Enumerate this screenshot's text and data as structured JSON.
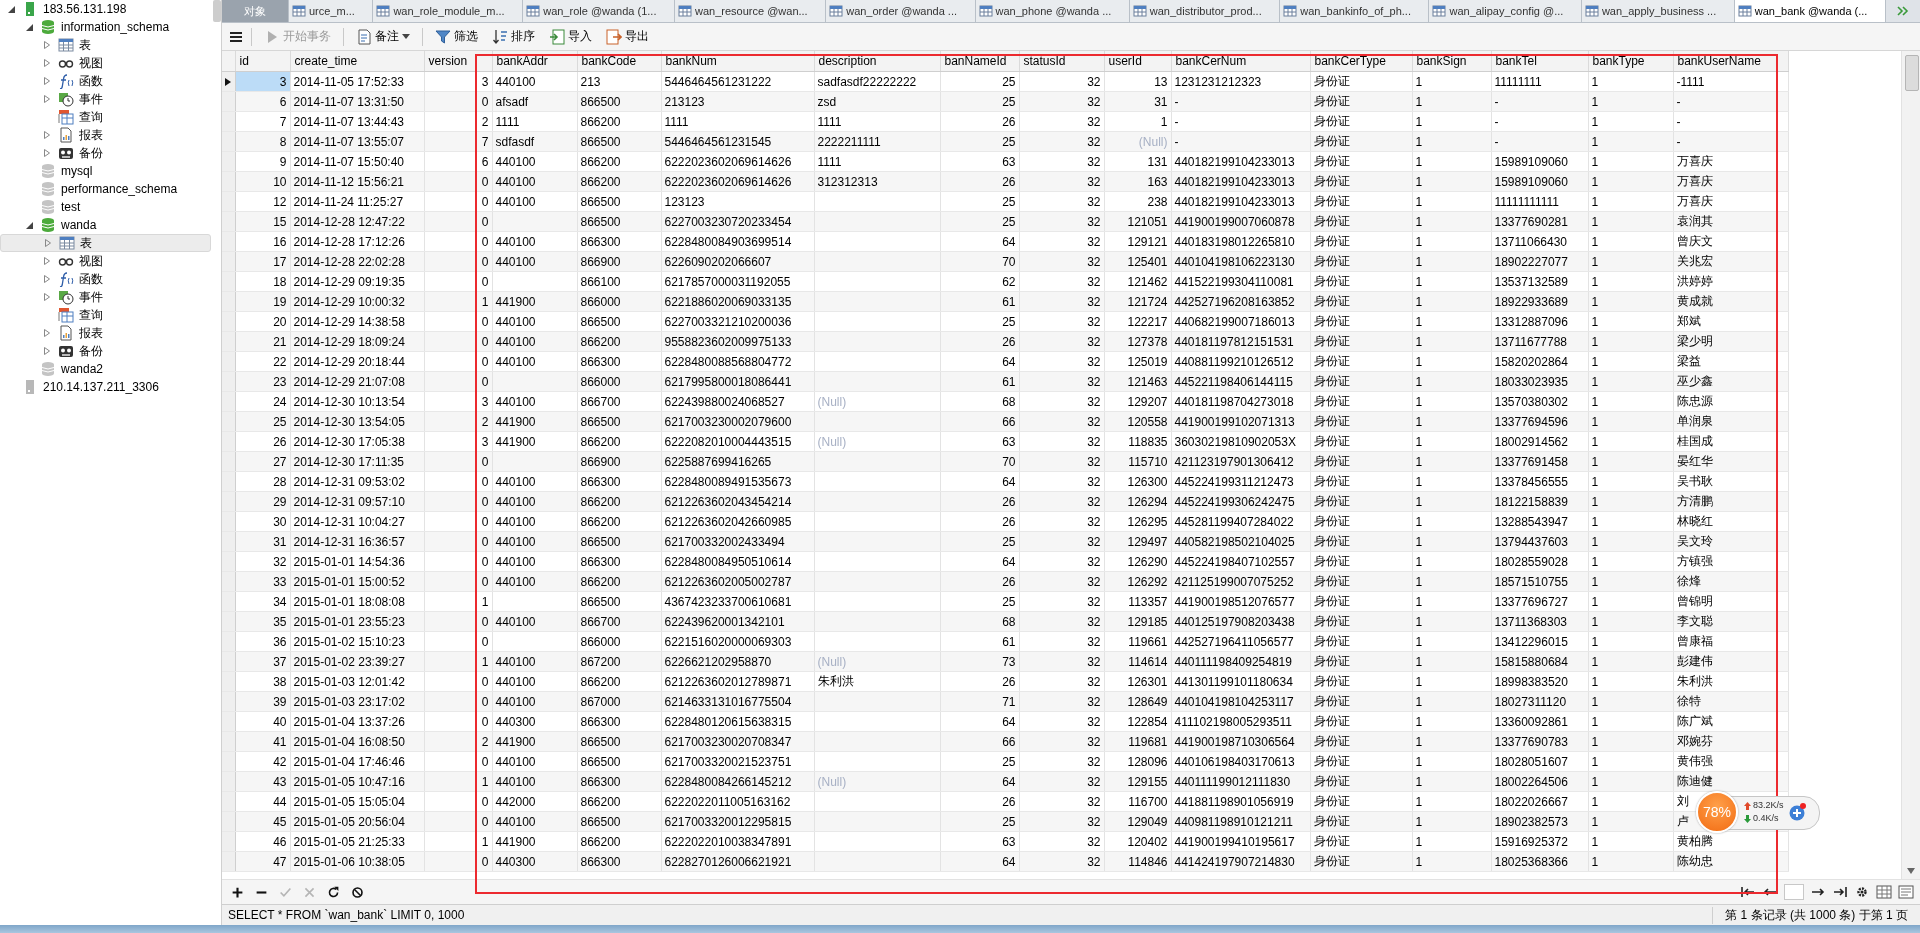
{
  "sidebar": {
    "tree": [
      {
        "kind": "server",
        "label": "183.56.131.198",
        "connected": true,
        "expanded": true,
        "selected": false,
        "children": [
          {
            "kind": "database",
            "label": "information_schema",
            "connected": true,
            "expanded": true,
            "selected": false,
            "children": [
              {
                "kind": "tables",
                "label": "表",
                "expanded": false,
                "selected": false
              },
              {
                "kind": "views",
                "label": "视图",
                "expanded": false,
                "selected": false
              },
              {
                "kind": "functions",
                "label": "函数",
                "expanded": false,
                "selected": false
              },
              {
                "kind": "events",
                "label": "事件",
                "expanded": false,
                "selected": false
              },
              {
                "kind": "queries",
                "label": "查询",
                "selected": false
              },
              {
                "kind": "reports",
                "label": "报表",
                "expanded": false,
                "selected": false
              },
              {
                "kind": "backups",
                "label": "备份",
                "expanded": false,
                "selected": false
              }
            ]
          },
          {
            "kind": "database",
            "label": "mysql",
            "connected": false,
            "selected": false
          },
          {
            "kind": "database",
            "label": "performance_schema",
            "connected": false,
            "selected": false
          },
          {
            "kind": "database",
            "label": "test",
            "connected": false,
            "selected": false
          },
          {
            "kind": "database",
            "label": "wanda",
            "connected": true,
            "expanded": true,
            "selected": false,
            "children": [
              {
                "kind": "tables",
                "label": "表",
                "expanded": false,
                "selected": true
              },
              {
                "kind": "views",
                "label": "视图",
                "expanded": false,
                "selected": false
              },
              {
                "kind": "functions",
                "label": "函数",
                "expanded": false,
                "selected": false
              },
              {
                "kind": "events",
                "label": "事件",
                "expanded": false,
                "selected": false
              },
              {
                "kind": "queries",
                "label": "查询",
                "selected": false
              },
              {
                "kind": "reports",
                "label": "报表",
                "expanded": false,
                "selected": false
              },
              {
                "kind": "backups",
                "label": "备份",
                "expanded": false,
                "selected": false
              }
            ]
          },
          {
            "kind": "database",
            "label": "wanda2",
            "connected": false,
            "selected": false
          }
        ]
      },
      {
        "kind": "server",
        "label": "210.14.137.211_3306",
        "connected": false,
        "selected": false
      }
    ]
  },
  "tabs": [
    {
      "kind": "objects",
      "label": "对象",
      "selected": false
    },
    {
      "kind": "table",
      "label": "urce_m...",
      "selected": false
    },
    {
      "kind": "table",
      "label": "wan_role_module_m...",
      "selected": false
    },
    {
      "kind": "table",
      "label": "wan_role @wanda (1...",
      "selected": false
    },
    {
      "kind": "table",
      "label": "wan_resource @wan...",
      "selected": false
    },
    {
      "kind": "table",
      "label": "wan_order @wanda ...",
      "selected": false
    },
    {
      "kind": "table",
      "label": "wan_phone @wanda ...",
      "selected": false
    },
    {
      "kind": "table",
      "label": "wan_distributor_prod...",
      "selected": false
    },
    {
      "kind": "table",
      "label": "wan_bankinfo_of_ph...",
      "selected": false
    },
    {
      "kind": "table",
      "label": "wan_alipay_config @...",
      "selected": false
    },
    {
      "kind": "table",
      "label": "wan_apply_business ...",
      "selected": false
    },
    {
      "kind": "table",
      "label": "wan_bank @wanda (...",
      "selected": true
    }
  ],
  "toolbar": {
    "buttons": [
      {
        "kind": "transaction",
        "label": "开始事务",
        "disabled": true
      },
      {
        "kind": "memo",
        "label": "备注",
        "disabled": false,
        "dropdown": true
      },
      {
        "kind": "filter",
        "label": "筛选",
        "disabled": false
      },
      {
        "kind": "sort",
        "label": "排序",
        "disabled": false
      },
      {
        "kind": "import",
        "label": "导入",
        "disabled": false
      },
      {
        "kind": "export",
        "label": "导出",
        "disabled": false
      }
    ]
  },
  "table": {
    "columns": [
      {
        "label": "id"
      },
      {
        "label": "create_time"
      },
      {
        "label": "version"
      },
      {
        "label": "bankAddr"
      },
      {
        "label": "bankCode"
      },
      {
        "label": "bankNum"
      },
      {
        "label": "description"
      },
      {
        "label": "banNameId"
      },
      {
        "label": "statusId"
      },
      {
        "label": "userId"
      },
      {
        "label": "bankCerNum"
      },
      {
        "label": "bankCerType"
      },
      {
        "label": "bankSign"
      },
      {
        "label": "bankTel"
      },
      {
        "label": "bankType"
      },
      {
        "label": "bankUserName"
      }
    ],
    "rows": [
      {
        "selected": true,
        "cells": [
          "3",
          "2014-11-05 17:52:33",
          "3",
          "440100",
          "213",
          "5446464561231222",
          "sadfasdf22222222",
          "25",
          "32",
          "13",
          "1231231212323",
          "身份证",
          "1",
          "11111111",
          "1",
          "-1111"
        ]
      },
      {
        "selected": false,
        "cells": [
          "6",
          "2014-11-07 13:31:50",
          "0",
          "afsadf",
          "866500",
          "213123",
          "zsd",
          "25",
          "32",
          "31",
          "-",
          "身份证",
          "1",
          "-",
          "1",
          "-"
        ]
      },
      {
        "selected": false,
        "cells": [
          "7",
          "2014-11-07 13:44:43",
          "2",
          "1111",
          "866200",
          "1111",
          "1111",
          "26",
          "32",
          "1",
          "-",
          "身份证",
          "1",
          "-",
          "1",
          "-"
        ]
      },
      {
        "selected": false,
        "cells": [
          "8",
          "2014-11-07 13:55:07",
          "7",
          "sdfasdf",
          "866500",
          "5446464561231545",
          "2222211111",
          "25",
          "32",
          {
            "text": "(Null)",
            "null": true
          },
          "-",
          "身份证",
          "1",
          "-",
          "1",
          "-"
        ]
      },
      {
        "selected": false,
        "cells": [
          "9",
          "2014-11-07 15:50:40",
          "6",
          "440100",
          "866200",
          "6222023602069614626",
          "1111",
          "63",
          "32",
          "131",
          "440182199104233013",
          "身份证",
          "1",
          "15989109060",
          "1",
          "万喜庆"
        ]
      },
      {
        "selected": false,
        "cells": [
          "10",
          "2014-11-12 15:56:21",
          "0",
          "440100",
          "866200",
          "6222023602069614626",
          "312312313",
          "26",
          "32",
          "163",
          "440182199104233013",
          "身份证",
          "1",
          "15989109060",
          "1",
          "万喜庆"
        ]
      },
      {
        "selected": false,
        "cells": [
          "12",
          "2014-11-24 11:25:27",
          "0",
          "440100",
          "866500",
          "123123",
          null,
          "25",
          "32",
          "238",
          "440182199104233013",
          "身份证",
          "1",
          "11111111111",
          "1",
          "万喜庆"
        ]
      },
      {
        "selected": false,
        "cells": [
          "15",
          "2014-12-28 12:47:22",
          "0",
          null,
          "866500",
          "6227003230720233454",
          null,
          "25",
          "32",
          "121051",
          "441900199007060878",
          "身份证",
          "1",
          "13377690281",
          "1",
          "袁润其"
        ]
      },
      {
        "selected": false,
        "cells": [
          "16",
          "2014-12-28 17:12:26",
          "0",
          "440100",
          "866300",
          "6228480084903699514",
          null,
          "64",
          "32",
          "129121",
          "440183198012265810",
          "身份证",
          "1",
          "13711066430",
          "1",
          "曾庆文"
        ]
      },
      {
        "selected": false,
        "cells": [
          "17",
          "2014-12-28 22:02:28",
          "0",
          "440100",
          "866900",
          "6226090202066607",
          null,
          "70",
          "32",
          "125401",
          "440104198106223130",
          "身份证",
          "1",
          "18902227077",
          "1",
          "关兆宏"
        ]
      },
      {
        "selected": false,
        "cells": [
          "18",
          "2014-12-29 09:19:35",
          "0",
          null,
          "866100",
          "6217857000031192055",
          null,
          "62",
          "32",
          "121462",
          "441522199304110081",
          "身份证",
          "1",
          "13537132589",
          "1",
          "洪婷婷"
        ]
      },
      {
        "selected": false,
        "cells": [
          "19",
          "2014-12-29 10:00:32",
          "1",
          "441900",
          "866000",
          "6221886020069033135",
          null,
          "61",
          "32",
          "121724",
          "442527196208163852",
          "身份证",
          "1",
          "18922933689",
          "1",
          "黄成就"
        ]
      },
      {
        "selected": false,
        "cells": [
          "20",
          "2014-12-29 14:38:58",
          "0",
          "440100",
          "866500",
          "6227003321210200036",
          null,
          "25",
          "32",
          "122217",
          "440682199007186013",
          "身份证",
          "1",
          "13312887096",
          "1",
          "郑斌"
        ]
      },
      {
        "selected": false,
        "cells": [
          "21",
          "2014-12-29 18:09:24",
          "0",
          "440100",
          "866200",
          "9558823602009975133",
          null,
          "26",
          "32",
          "127378",
          "440181197812151531",
          "身份证",
          "1",
          "13711677788",
          "1",
          "梁少明"
        ]
      },
      {
        "selected": false,
        "cells": [
          "22",
          "2014-12-29 20:18:44",
          "0",
          "440100",
          "866300",
          "6228480088568804772",
          null,
          "64",
          "32",
          "125019",
          "440881199210126512",
          "身份证",
          "1",
          "15820202864",
          "1",
          "梁益"
        ]
      },
      {
        "selected": false,
        "cells": [
          "23",
          "2014-12-29 21:07:08",
          "0",
          null,
          "866000",
          "6217995800018086441",
          null,
          "61",
          "32",
          "121463",
          "445221198406144115",
          "身份证",
          "1",
          "18033023935",
          "1",
          "巫少鑫"
        ]
      },
      {
        "selected": false,
        "cells": [
          "24",
          "2014-12-30 10:13:54",
          "3",
          "440100",
          "866700",
          "622439880024068527",
          {
            "text": "(Null)",
            "null": true
          },
          "68",
          "32",
          "129207",
          "440181198704273018",
          "身份证",
          "1",
          "13570380302",
          "1",
          "陈忠源"
        ]
      },
      {
        "selected": false,
        "cells": [
          "25",
          "2014-12-30 13:54:05",
          "2",
          "441900",
          "866500",
          "6217003230002079600",
          null,
          "66",
          "32",
          "120558",
          "441900199102071313",
          "身份证",
          "1",
          "13377694596",
          "1",
          "单润泉"
        ]
      },
      {
        "selected": false,
        "cells": [
          "26",
          "2014-12-30 17:05:38",
          "3",
          "441900",
          "866200",
          "6222082010004443515",
          {
            "text": "(Null)",
            "null": true
          },
          "63",
          "32",
          "118835",
          "36030219810902053X",
          "身份证",
          "1",
          "18002914562",
          "1",
          "桂国成"
        ]
      },
      {
        "selected": false,
        "cells": [
          "27",
          "2014-12-30 17:11:35",
          "0",
          null,
          "866900",
          "6225887699416265",
          null,
          "70",
          "32",
          "115710",
          "421123197901306412",
          "身份证",
          "1",
          "13377691458",
          "1",
          "晏红华"
        ]
      },
      {
        "selected": false,
        "cells": [
          "28",
          "2014-12-31 09:53:02",
          "0",
          "440100",
          "866300",
          "6228480089491535673",
          null,
          "64",
          "32",
          "126300",
          "445224199311212473",
          "身份证",
          "1",
          "13378456555",
          "1",
          "吴书耿"
        ]
      },
      {
        "selected": false,
        "cells": [
          "29",
          "2014-12-31 09:57:10",
          "0",
          "440100",
          "866200",
          "6212263602043454214",
          null,
          "26",
          "32",
          "126294",
          "445224199306242475",
          "身份证",
          "1",
          "18122158839",
          "1",
          "方清鹏"
        ]
      },
      {
        "selected": false,
        "cells": [
          "30",
          "2014-12-31 10:04:27",
          "0",
          "440100",
          "866200",
          "6212263602042660985",
          null,
          "26",
          "32",
          "126295",
          "445281199407284022",
          "身份证",
          "1",
          "13288543947",
          "1",
          "林晓红"
        ]
      },
      {
        "selected": false,
        "cells": [
          "31",
          "2014-12-31 16:36:57",
          "0",
          "440100",
          "866500",
          "621700332002433494",
          null,
          "25",
          "32",
          "129497",
          "440582198502104025",
          "身份证",
          "1",
          "13794437603",
          "1",
          "吴文玲"
        ]
      },
      {
        "selected": false,
        "cells": [
          "32",
          "2015-01-01 14:54:36",
          "0",
          "440100",
          "866300",
          "6228480084950510614",
          null,
          "64",
          "32",
          "126290",
          "445224198407102557",
          "身份证",
          "1",
          "18028559028",
          "1",
          "方镇强"
        ]
      },
      {
        "selected": false,
        "cells": [
          "33",
          "2015-01-01 15:00:52",
          "0",
          "440100",
          "866200",
          "6212263602005002787",
          null,
          "26",
          "32",
          "126292",
          "421125199007075252",
          "身份证",
          "1",
          "18571510755",
          "1",
          "徐烽"
        ]
      },
      {
        "selected": false,
        "cells": [
          "34",
          "2015-01-01 18:08:08",
          "1",
          null,
          "866500",
          "4367423233700610681",
          null,
          "25",
          "32",
          "113357",
          "441900198512076577",
          "身份证",
          "1",
          "13377696727",
          "1",
          "曾锦明"
        ]
      },
      {
        "selected": false,
        "cells": [
          "35",
          "2015-01-01 23:55:23",
          "0",
          "440100",
          "866700",
          "622439620001342101",
          null,
          "68",
          "32",
          "129185",
          "440125197908203438",
          "身份证",
          "1",
          "13711368303",
          "1",
          "李文聪"
        ]
      },
      {
        "selected": false,
        "cells": [
          "36",
          "2015-01-02 15:10:23",
          "0",
          null,
          "866000",
          "6221516020000069303",
          null,
          "61",
          "32",
          "119661",
          "442527196411056577",
          "身份证",
          "1",
          "13412296015",
          "1",
          "曾康福"
        ]
      },
      {
        "selected": false,
        "cells": [
          "37",
          "2015-01-02 23:39:27",
          "1",
          "440100",
          "867200",
          "6226621202958870",
          {
            "text": "(Null)",
            "null": true
          },
          "73",
          "32",
          "114614",
          "440111198409254819",
          "身份证",
          "1",
          "15815880684",
          "1",
          "彭建伟"
        ]
      },
      {
        "selected": false,
        "cells": [
          "38",
          "2015-01-03 12:01:42",
          "0",
          "440100",
          "866200",
          "6212263602012789871",
          "朱利洪",
          "26",
          "32",
          "126301",
          "441301199101180634",
          "身份证",
          "1",
          "18998383520",
          "1",
          "朱利洪"
        ]
      },
      {
        "selected": false,
        "cells": [
          "39",
          "2015-01-03 23:17:02",
          "0",
          "440100",
          "867000",
          "6214633131016775504",
          null,
          "71",
          "32",
          "128649",
          "440104198104253117",
          "身份证",
          "1",
          "18027311120",
          "1",
          "徐特"
        ]
      },
      {
        "selected": false,
        "cells": [
          "40",
          "2015-01-04 13:37:26",
          "0",
          "440300",
          "866300",
          "6228480120615638315",
          null,
          "64",
          "32",
          "122854",
          "411102198005293511",
          "身份证",
          "1",
          "13360092861",
          "1",
          "陈广斌"
        ]
      },
      {
        "selected": false,
        "cells": [
          "41",
          "2015-01-04 16:08:50",
          "2",
          "441900",
          "866500",
          "6217003230020708347",
          null,
          "66",
          "32",
          "119681",
          "441900198710306564",
          "身份证",
          "1",
          "13377690783",
          "1",
          "邓婉芬"
        ]
      },
      {
        "selected": false,
        "cells": [
          "42",
          "2015-01-04 17:46:46",
          "0",
          "440100",
          "866500",
          "6217003320021523751",
          null,
          "25",
          "32",
          "128096",
          "440106198403170613",
          "身份证",
          "1",
          "18028051607",
          "1",
          "黄伟强"
        ]
      },
      {
        "selected": false,
        "cells": [
          "43",
          "2015-01-05 10:47:16",
          "1",
          "440100",
          "866300",
          "6228480084266145212",
          {
            "text": "(Null)",
            "null": true
          },
          "64",
          "32",
          "129155",
          "440111199012111830",
          "身份证",
          "1",
          "18002264506",
          "1",
          "陈迪健"
        ]
      },
      {
        "selected": false,
        "cells": [
          "44",
          "2015-01-05 15:05:04",
          "0",
          "442000",
          "866200",
          "6222022011005163162",
          null,
          "26",
          "32",
          "116700",
          "441881198901056919",
          "身份证",
          "1",
          "18022026667",
          "1",
          "刘"
        ]
      },
      {
        "selected": false,
        "cells": [
          "45",
          "2015-01-05 20:56:04",
          "0",
          "440100",
          "866500",
          "6217003320012295815",
          null,
          "25",
          "32",
          "129049",
          "440981198910121211",
          "身份证",
          "1",
          "18902382573",
          "1",
          "卢"
        ]
      },
      {
        "selected": false,
        "cells": [
          "46",
          "2015-01-05 21:25:33",
          "1",
          "441900",
          "866200",
          "6222022010038347891",
          null,
          "63",
          "32",
          "120402",
          "441900199410195617",
          "身份证",
          "1",
          "15916925372",
          "1",
          "黄柏腾"
        ]
      },
      {
        "selected": false,
        "cells": [
          "47",
          "2015-01-06 10:38:05",
          "0",
          "440300",
          "866300",
          "6228270126006621921",
          null,
          "64",
          "32",
          "114846",
          "441424197907214830",
          "身份证",
          "1",
          "18025368366",
          "1",
          "陈幼忠"
        ]
      }
    ]
  },
  "record_tools": [
    {
      "kind": "add",
      "disabled": false
    },
    {
      "kind": "delete",
      "disabled": false
    },
    {
      "kind": "apply",
      "disabled": true
    },
    {
      "kind": "discard",
      "disabled": true
    },
    {
      "kind": "refresh",
      "disabled": false
    },
    {
      "kind": "stop",
      "disabled": false
    }
  ],
  "status_bar": {
    "query": "SELECT * FROM `wan_bank` LIMIT 0, 1000",
    "record_info": "第 1 条记录 (共 1000 条) 于第 1 页"
  },
  "speed_widget": {
    "percent": "78%",
    "upload": "83.2K/s",
    "download": "0.4K/s"
  }
}
